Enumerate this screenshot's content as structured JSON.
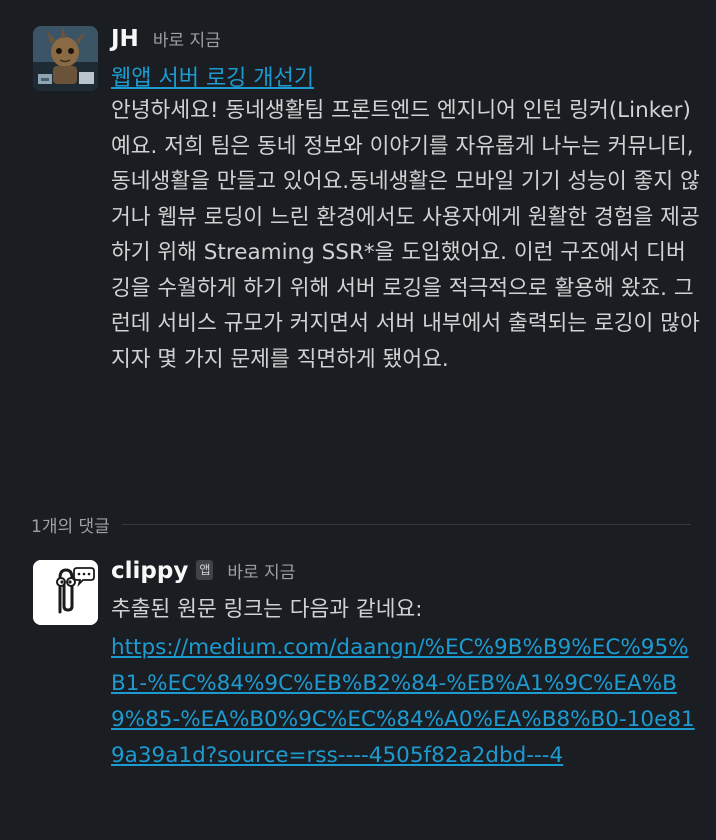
{
  "post": {
    "author": "JH",
    "timestamp": "바로 지금",
    "title": "웹앱 서버 로깅 개선기",
    "body": "안녕하세요! 동네생활팀 프론트엔드 엔지니어 인턴 링커(Linker)예요. 저희 팀은 동네 정보와 이야기를 자유롭게 나누는 커뮤니티, 동네생활을 만들고 있어요.동네생활은 모바일 기기 성능이 좋지 않거나 웹뷰 로딩이 느린 환경에서도 사용자에게 원활한 경험을 제공하기 위해 Streaming SSR*을 도입했어요. 이런 구조에서 디버깅을 수월하게 하기 위해 서버 로깅을 적극적으로 활용해 왔죠. 그런데 서비스 규모가 커지면서 서버 내부에서 출력되는 로깅이 많아지자 몇 가지 문제를 직면하게 됐어요."
  },
  "thread": {
    "reply_count": "1개의 댓글"
  },
  "reply": {
    "author": "clippy",
    "badge": "앱",
    "timestamp": "바로 지금",
    "text": "추출된 원문 링크는 다음과 같네요:",
    "url": "https://medium.com/daangn/%EC%9B%B9%EC%95%B1-%EC%84%9C%EB%B2%84-%EB%A1%9C%EA%B9%85-%EA%B0%9C%EC%84%A0%EA%B8%B0-10e819a39a1d?source=rss----4505f82a2dbd---4"
  },
  "colors": {
    "background": "#1a1d21",
    "link": "#1d9bd1",
    "text": "#d1d2d3",
    "muted": "#9da0a3"
  }
}
